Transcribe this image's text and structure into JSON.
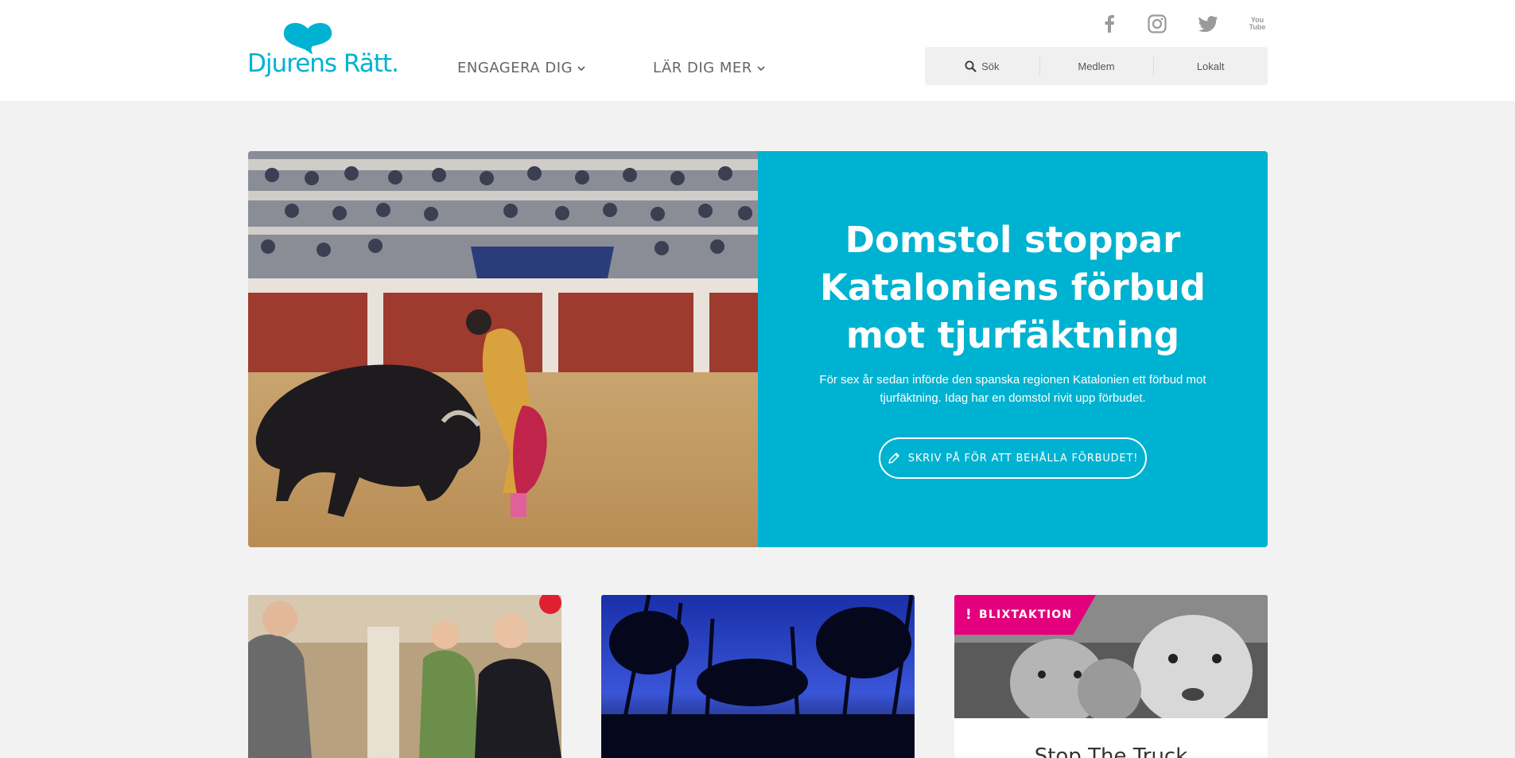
{
  "brand": {
    "name": "Djurens Rätt.",
    "color": "#00b2d1"
  },
  "nav": [
    {
      "label": "ENGAGERA DIG"
    },
    {
      "label": "LÄR DIG MER"
    }
  ],
  "social": {
    "facebook": "facebook-icon",
    "instagram": "instagram-icon",
    "twitter": "twitter-icon",
    "youtube": {
      "icon": "youtube-icon",
      "line1": "You",
      "line2": "Tube"
    }
  },
  "toolbar": {
    "search_label": "Sök",
    "member_label": "Medlem",
    "local_label": "Lokalt"
  },
  "hero": {
    "title": "Domstol stoppar Kataloniens förbud mot tjurfäktning",
    "text": "För sex år sedan införde den spanska regionen Katalonien ett förbud mot tjurfäktning. Idag har en domstol rivit upp förbudet.",
    "button_label": "SKRIV PÅ FÖR ATT BEHÅLLA FÖRBUDET!",
    "panel_color": "#00b2d1"
  },
  "cards": [
    {
      "image": "people-at-stand-photo"
    },
    {
      "image": "night-forest-photo"
    },
    {
      "badge": "BLIXTAKTION",
      "badge_color": "#e4007c",
      "title": "Stop The Truck",
      "image": "sheep-photo"
    }
  ]
}
